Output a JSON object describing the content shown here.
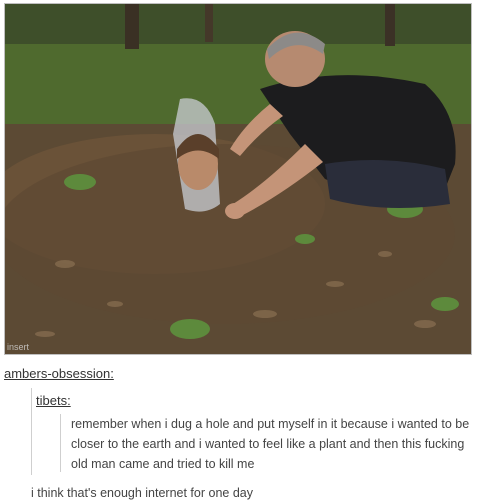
{
  "post": {
    "image": {
      "watermark": "insert",
      "description_icon": "photo-icon"
    },
    "poster_username": "ambers-obsession:",
    "reblog": {
      "username": "tibets:",
      "text": "remember when i dug a hole and put myself in it because i wanted to be closer to the earth and i wanted to feel like a plant and then this fucking old man came and tried to kill me"
    },
    "caption": "i think that's enough internet for one day"
  },
  "colors": {
    "link": "#333333",
    "text": "#444444",
    "border": "#cfcfcf"
  }
}
